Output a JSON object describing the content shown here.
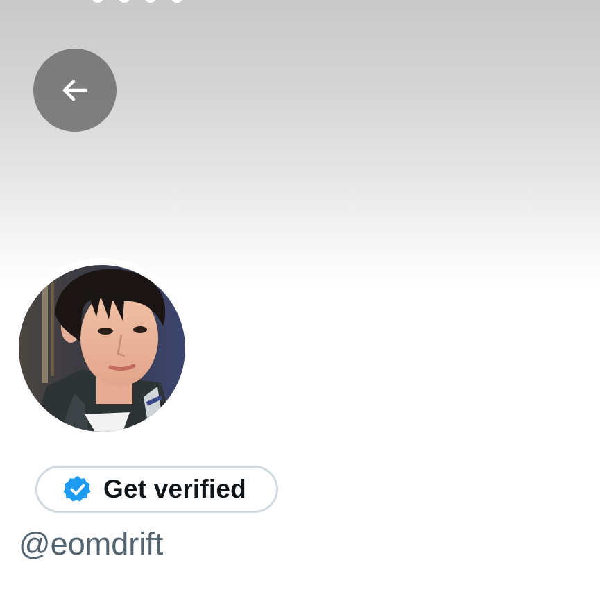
{
  "header": {
    "back_icon": "arrow-left-icon",
    "banner_color_top": "#c9c9c9",
    "banner_color_bottom": "#ffffff"
  },
  "profile": {
    "avatar_description": "profile-photo",
    "verify_button_label": "Get verified",
    "verify_badge_icon": "verified-badge-icon",
    "verify_badge_color": "#1d9bf0",
    "handle": "@eomdrift"
  }
}
